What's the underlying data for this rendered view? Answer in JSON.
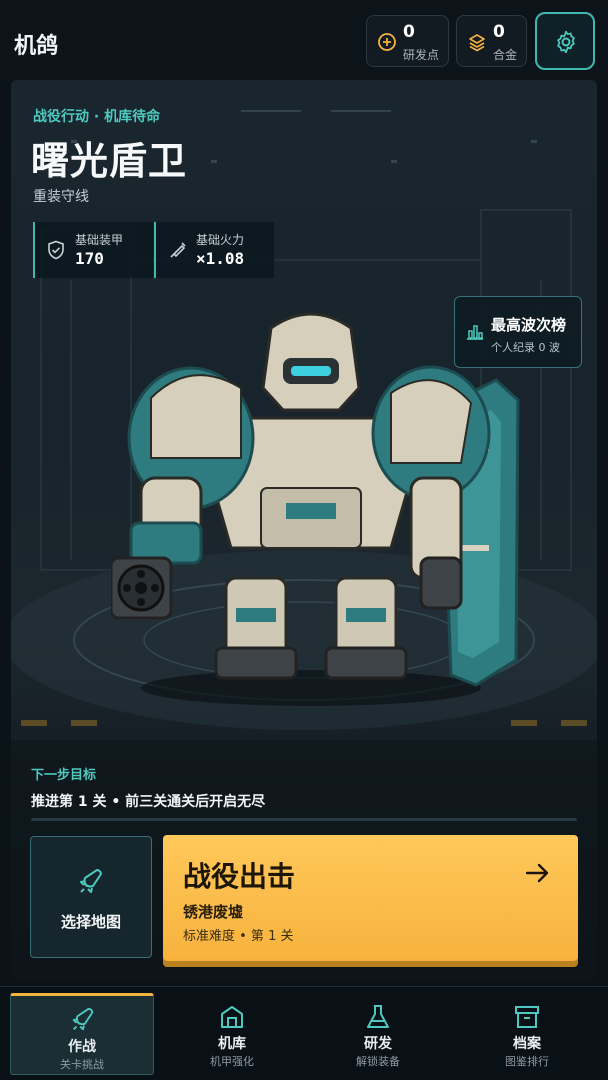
{
  "app": {
    "title": "机鸽"
  },
  "resources": [
    {
      "icon": "plus-circle-icon",
      "value": "0",
      "label": "研发点"
    },
    {
      "icon": "layers-icon",
      "value": "0",
      "label": "合金"
    }
  ],
  "settings": {
    "icon": "gear-icon"
  },
  "hero": {
    "mission_tag": "战役行动 · 机库待命",
    "mech_name": "曙光盾卫",
    "mech_class": "重装守线",
    "stats": [
      {
        "icon": "shield-icon",
        "label": "基础装甲",
        "value": "170"
      },
      {
        "icon": "gun-icon",
        "label": "基础火力",
        "value": "×1.08"
      }
    ]
  },
  "leaderboard": {
    "title": "最高波次榜",
    "subtitle": "个人纪录 0 波",
    "icon": "bar-chart-icon"
  },
  "next_goal": {
    "label": "下一步目标",
    "text": "推进第 1 关 • 前三关通关后开启无尽"
  },
  "actions": {
    "map_button": {
      "label": "选择地图",
      "icon": "rocket-icon"
    },
    "launch": {
      "title": "战役出击",
      "stage": "锈港废墟",
      "difficulty": "标准难度 • 第 1 关",
      "icon": "arrow-right-icon"
    }
  },
  "nav": [
    {
      "label": "作战",
      "sub": "关卡挑战",
      "icon": "rocket-icon",
      "active": true
    },
    {
      "label": "机库",
      "sub": "机甲强化",
      "icon": "hangar-icon",
      "active": false
    },
    {
      "label": "研发",
      "sub": "解锁装备",
      "icon": "flask-icon",
      "active": false
    },
    {
      "label": "档案",
      "sub": "图鉴排行",
      "icon": "archive-icon",
      "active": false
    }
  ],
  "colors": {
    "accent": "#3fb8b0",
    "launch": "#f7b23d",
    "background": "#0b1218"
  }
}
